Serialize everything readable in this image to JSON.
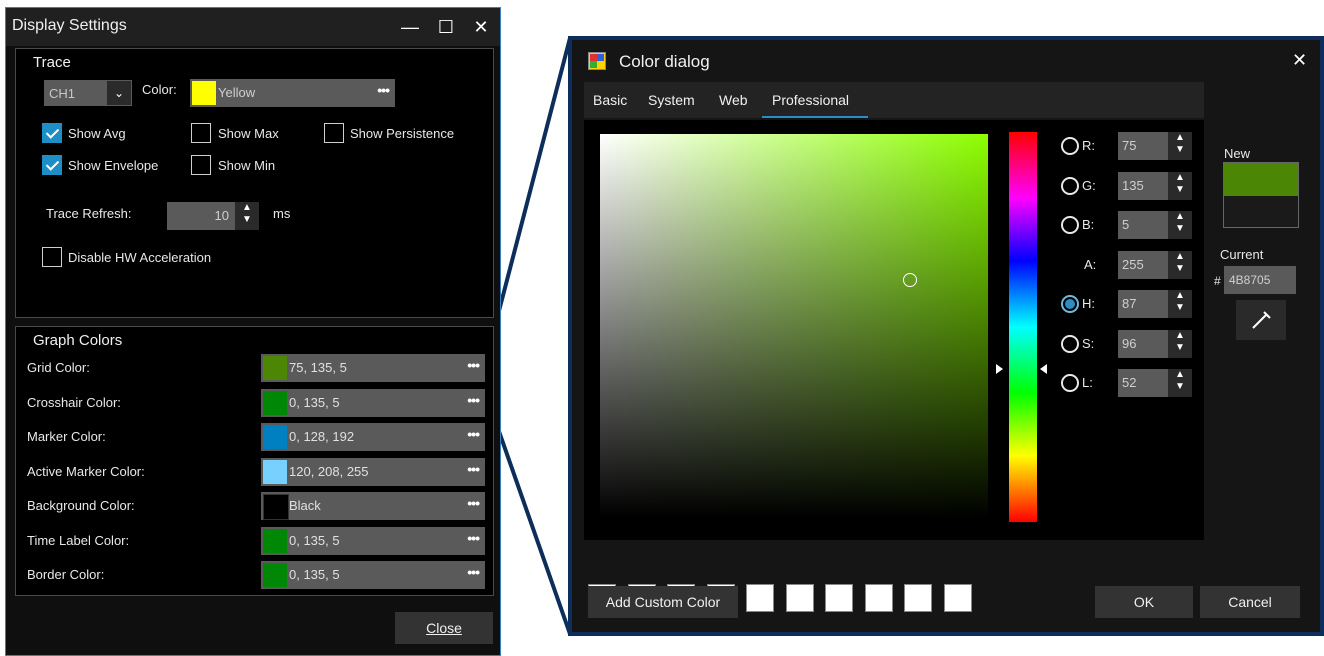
{
  "display_settings": {
    "title": "Display Settings",
    "window_buttons": {
      "minimize": "—",
      "maximize": "☐",
      "close": "✕"
    },
    "trace": {
      "group_title": "Trace",
      "channel": "CH1",
      "color_label": "Color:",
      "color_value": "Yellow",
      "color_swatch": "#ffff00",
      "checkboxes": {
        "show_avg": {
          "label": "Show Avg",
          "checked": true
        },
        "show_max": {
          "label": "Show Max",
          "checked": false
        },
        "show_persistence": {
          "label": "Show Persistence",
          "checked": false
        },
        "show_envelope": {
          "label": "Show Envelope",
          "checked": true
        },
        "show_min": {
          "label": "Show Min",
          "checked": false
        },
        "disable_hw": {
          "label": "Disable HW Acceleration",
          "checked": false
        }
      },
      "refresh_label": "Trace Refresh:",
      "refresh_value": "10",
      "refresh_unit": "ms"
    },
    "graph_colors": {
      "group_title": "Graph Colors",
      "rows": [
        {
          "label": "Grid Color:",
          "value": "75, 135, 5",
          "swatch": "#4b8705"
        },
        {
          "label": "Crosshair Color:",
          "value": "0, 135, 5",
          "swatch": "#008705"
        },
        {
          "label": "Marker Color:",
          "value": "0, 128, 192",
          "swatch": "#0080c0"
        },
        {
          "label": "Active Marker Color:",
          "value": "120, 208, 255",
          "swatch": "#78d0ff"
        },
        {
          "label": "Background Color:",
          "value": "Black",
          "swatch": "#000000"
        },
        {
          "label": "Time Label Color:",
          "value": "0, 135, 5",
          "swatch": "#008705"
        },
        {
          "label": "Border Color:",
          "value": "0, 135, 5",
          "swatch": "#008705"
        }
      ]
    },
    "close_label": "Close"
  },
  "color_dialog": {
    "title": "Color dialog",
    "close": "✕",
    "tabs": [
      "Basic",
      "System",
      "Web",
      "Professional"
    ],
    "active_tab": "Professional",
    "channels": [
      {
        "name": "R:",
        "value": "75",
        "selected": false,
        "radio": true
      },
      {
        "name": "G:",
        "value": "135",
        "selected": false,
        "radio": true
      },
      {
        "name": "B:",
        "value": "5",
        "selected": false,
        "radio": true
      },
      {
        "name": "A:",
        "value": "255",
        "selected": false,
        "radio": false
      },
      {
        "name": "H:",
        "value": "87",
        "selected": true,
        "radio": true
      },
      {
        "name": "S:",
        "value": "96",
        "selected": false,
        "radio": true
      },
      {
        "name": "L:",
        "value": "52",
        "selected": false,
        "radio": true
      }
    ],
    "new_label": "New",
    "new_color": "#4b8705",
    "current_label": "Current",
    "hex_prefix": "#",
    "hex_value": "4B8705",
    "add_custom_label": "Add Custom Color",
    "ok_label": "OK",
    "cancel_label": "Cancel",
    "hue": 87
  }
}
